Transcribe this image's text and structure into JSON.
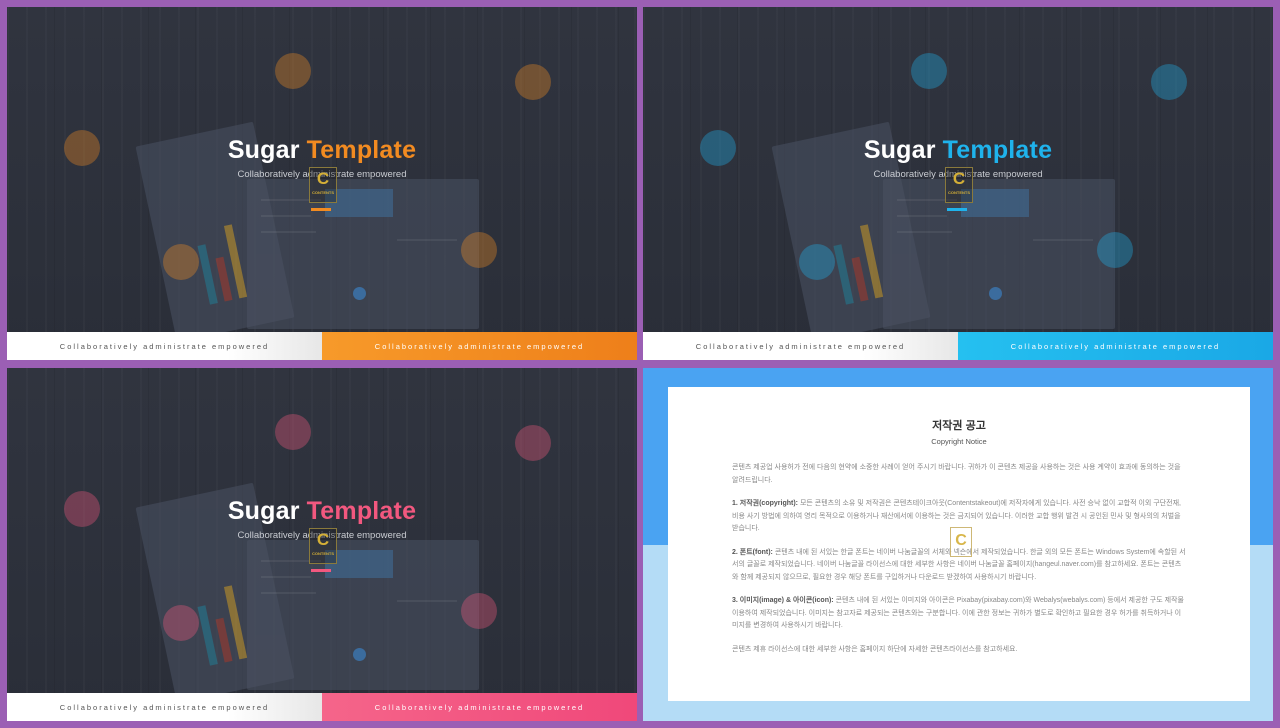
{
  "slides": [
    {
      "title_main": "Sugar",
      "title_accent": "Template",
      "subtitle": "Collaboratively administrate empowered",
      "footer_left": "Collaboratively administrate empowered",
      "footer_right": "Collaboratively administrate empowered",
      "accent_color": "#f28b21"
    },
    {
      "title_main": "Sugar",
      "title_accent": "Template",
      "subtitle": "Collaboratively administrate empowered",
      "footer_left": "Collaboratively administrate empowered",
      "footer_right": "Collaboratively administrate empowered",
      "accent_color": "#1fb3ec"
    },
    {
      "title_main": "Sugar",
      "title_accent": "Template",
      "subtitle": "Collaboratively administrate empowered",
      "footer_left": "Collaboratively administrate empowered",
      "footer_right": "Collaboratively administrate empowered",
      "accent_color": "#f2587f"
    }
  ],
  "logo": {
    "letter": "C",
    "text": "CONTENTS"
  },
  "notice": {
    "title": "저작권 공고",
    "subtitle": "Copyright Notice",
    "intro": "콘텐츠 제공업 사용허가 전에 다음의 현약에 소중한 사례이 얻어 주시기 바랍니다. 귀하가 이 콘텐츠 제공을 사용하는 것은 사용 계약이 효과에 동의하는 것을 알려드립니다.",
    "s1_head": "1. 저작권(copyright):",
    "s1_body": " 모든 콘텐츠의 소유 및 저작권은 콘텐츠테이크아웃(Contentstakeout)에 저작자에게 있습니다. 사전 승낙 없이 교합적 이외 구단전재, 비용 사기 방법에 의하여 영리 목적으로 이용하거나 재산에서에 이용하는 것은 금지되어 있습니다. 이러한 교합 행위 발견 시 공인된 민사 및 형사의의 처벌을 받습니다.",
    "s2_head": "2. 폰트(font):",
    "s2_body": " 콘텐츠 내에 된 서있는 한글 폰트는 네이버 나눔글꼴의 서체와 넥슨에서 제작되었습니다. 한글 외의 모든 폰트는 Windows System에 속할된 서서의 글꼴로 제작되었습니다. 네이버 나눔글꼴 라이선스에 대한 세부한 사항은 네이버 나눔글꼴 홈페이지(hangeul.naver.com)를 참고하세요. 폰트는 콘텐츠와 함께 제공되지 않으므로, 필요한 경우 해당 폰트를 구입하거나 다운로드 받겠하여 사용하시기 바랍니다.",
    "s3_head": "3. 이미지(image) & 아이콘(icon):",
    "s3_body": " 콘텐츠 내에 된 서있는 이미지와 아이콘은 Pixabay(pixabay.com)와 Webalys(webalys.com) 등에서 제공한 구도 제작물 이용하여 제작되었습니다. 이미지는 참고자료 제공되는 콘텐츠와는 구분합니다. 이에 관한 정보는 귀하가 별도로 확인하고 필요한 경우 허가를 취득하거나 이미지를 변경하여 사용하시기 바랍니다.",
    "outro": "콘텐츠 제휴 라이선스에 대한 세부한 사항은 홈페이지 하단에 자세한 콘텐츠라이선스를 참고하세요."
  }
}
